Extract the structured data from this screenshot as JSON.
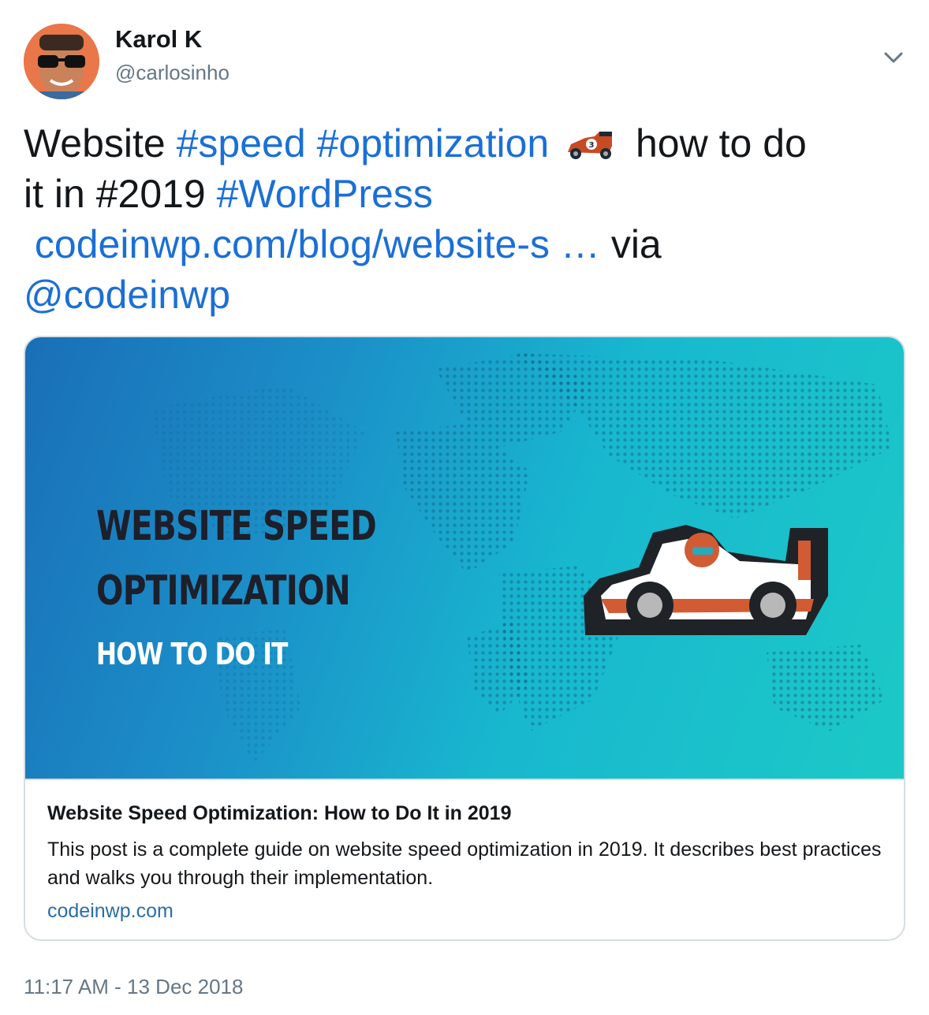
{
  "author": {
    "name": "Karol K",
    "handle": "@carlosinho"
  },
  "tweet": {
    "word_website": "Website",
    "hashtag_speed": "#speed",
    "hashtag_optimization": "#optimization",
    "emoji": "racing-car-emoji",
    "text_how_to_do": "how to do",
    "text_it_in": "it in #2019",
    "hashtag_wordpress": "#WordPress",
    "link_url": "codeinwp.com/blog/website-s …",
    "text_via": "via",
    "mention": "@codeinwp"
  },
  "card": {
    "hero_line1": "WEBSITE SPEED",
    "hero_line2": "OPTIMIZATION",
    "hero_line3": "HOW TO DO IT",
    "title": "Website Speed Optimization: How to Do It in 2019",
    "description": "This post is a complete guide on website speed optimization in 2019. It describes best practices and walks you through their implementation.",
    "domain": "codeinwp.com"
  },
  "timestamp": "11:17 AM - 13 Dec 2018",
  "icons": {
    "caret": "chevron-down-icon",
    "avatar": "avatar"
  },
  "colors": {
    "link": "#1b6fd6",
    "secondary_text": "#657786",
    "card_border": "#d6dde3",
    "card_domain": "#2a6ea8",
    "hero_gradient_start": "#1a6fb6",
    "hero_gradient_end": "#1cc9c6"
  }
}
